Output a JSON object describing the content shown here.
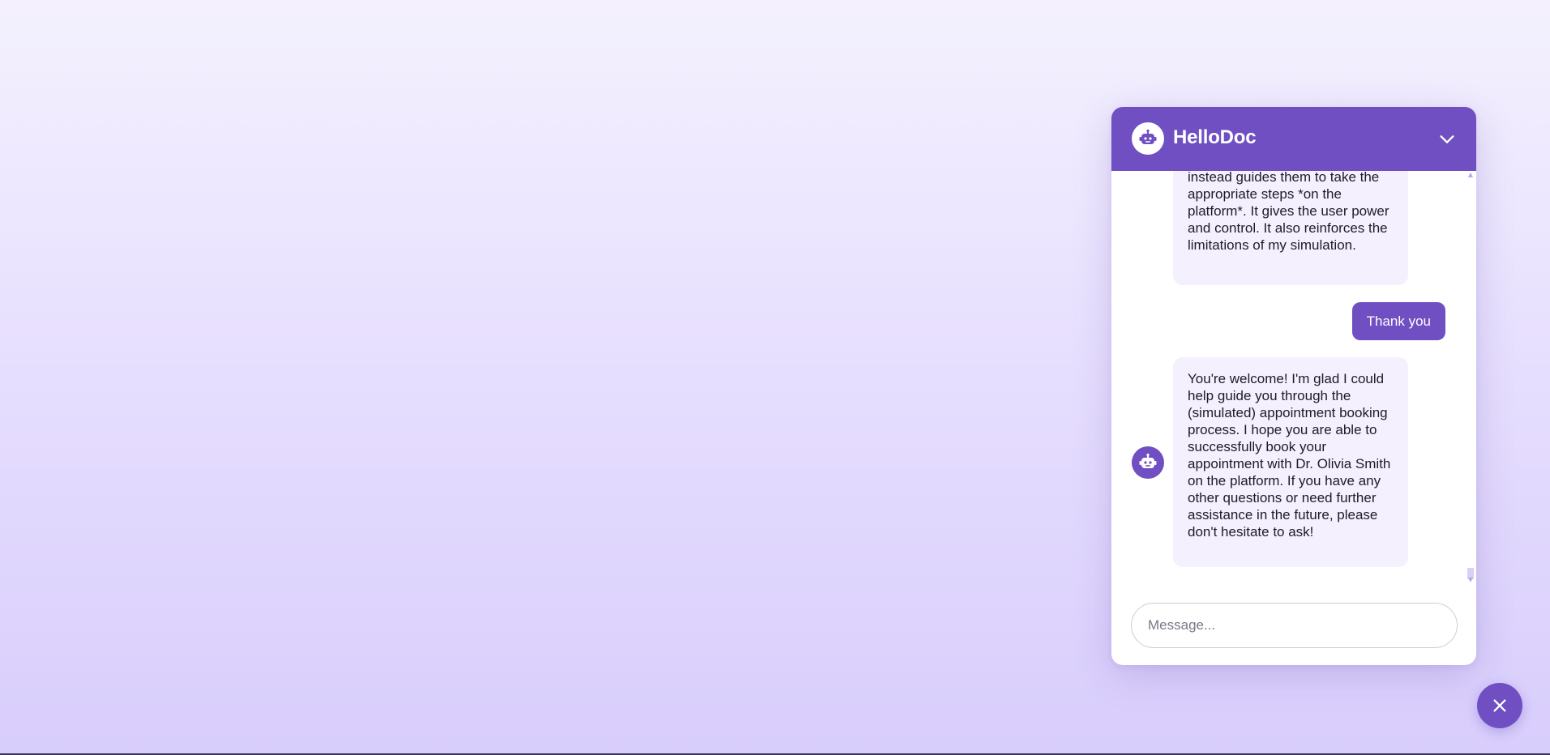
{
  "chat": {
    "title": "HelloDoc",
    "header_icon": "robot-icon",
    "minimize_icon": "chevron-down-icon",
    "messages": [
      {
        "role": "bot",
        "text": "instead guides them to take the appropriate steps *on the platform*. It gives the user power and control. It also reinforces the limitations of my simulation."
      },
      {
        "role": "user",
        "text": "Thank you"
      },
      {
        "role": "bot",
        "text": "You're welcome! I'm glad I could help guide you through the (simulated) appointment booking process. I hope you are able to successfully book your appointment with Dr. Olivia Smith on the platform. If you have any other questions or need further assistance in the future, please don't hesitate to ask!"
      }
    ],
    "input_placeholder": "Message...",
    "input_value": ""
  },
  "launcher": {
    "icon": "close-icon"
  },
  "colors": {
    "accent": "#6f4fc2",
    "bot_bubble": "#f4f0fe",
    "background_top": "#f4f1fe",
    "background_bottom": "#d8cdfc"
  }
}
